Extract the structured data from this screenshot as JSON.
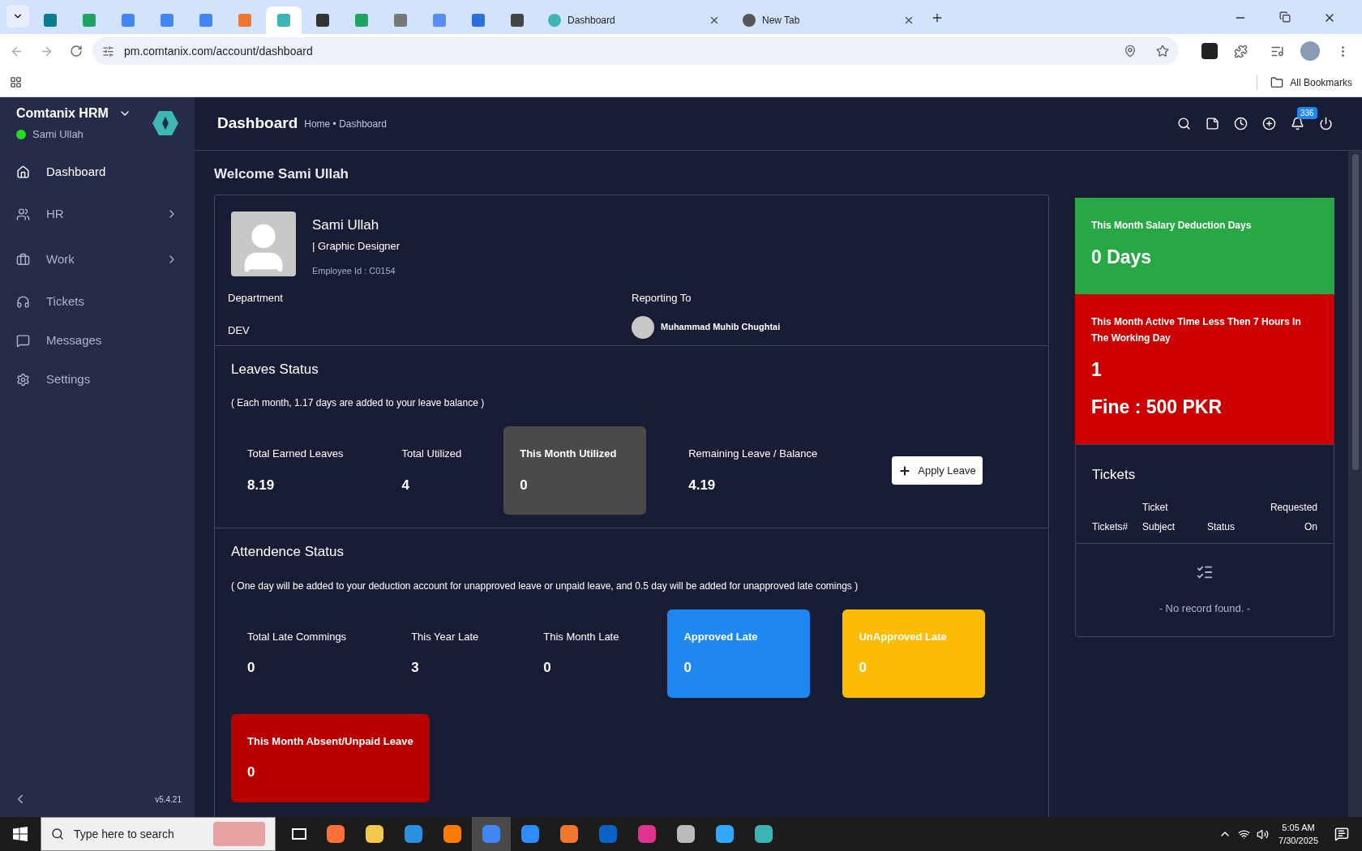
{
  "browser": {
    "tabs": [
      {
        "kind": "icon",
        "color": "#0b7c8f",
        "selected": false
      },
      {
        "kind": "icon",
        "color": "#1fa463",
        "selected": false
      },
      {
        "kind": "icon",
        "color": "#4285f4",
        "selected": false
      },
      {
        "kind": "icon",
        "color": "#4285f4",
        "selected": false
      },
      {
        "kind": "icon",
        "color": "#4285f4",
        "selected": false
      },
      {
        "kind": "icon",
        "color": "#f0772f",
        "selected": false
      },
      {
        "kind": "icon",
        "color": "#3cb4b4",
        "selected": true
      },
      {
        "kind": "icon",
        "color": "#333333",
        "selected": false
      },
      {
        "kind": "icon",
        "color": "#1fa463",
        "selected": false
      },
      {
        "kind": "icon",
        "color": "#777777",
        "selected": false
      },
      {
        "kind": "icon",
        "color": "#5b8def",
        "selected": false
      },
      {
        "kind": "icon",
        "color": "#2a6fdb",
        "selected": false
      },
      {
        "kind": "icon",
        "color": "#444444",
        "selected": false
      },
      {
        "kind": "titled",
        "color": "#3cb4b4",
        "title": "Dashboard",
        "selected": false
      },
      {
        "kind": "titled",
        "color": "#555555",
        "title": "New Tab",
        "selected": false
      }
    ],
    "url": "pm.comtanix.com/account/dashboard",
    "bookmarks": "All Bookmarks"
  },
  "sidebar": {
    "brand": "Comtanix HRM",
    "user": "Sami Ullah",
    "online": true,
    "items": [
      {
        "label": "Dashboard",
        "selected": true,
        "kind": "link"
      },
      {
        "label": "HR",
        "selected": false,
        "kind": "group"
      },
      {
        "label": "Work",
        "selected": false,
        "kind": "group"
      },
      {
        "label": "Tickets",
        "selected": false,
        "kind": "link"
      },
      {
        "label": "Messages",
        "selected": false,
        "kind": "link"
      },
      {
        "label": "Settings",
        "selected": false,
        "kind": "link"
      }
    ],
    "version": "v5.4.21"
  },
  "header": {
    "title": "Dashboard",
    "breadcrumb": "Home • Dashboard",
    "notification_count": "336"
  },
  "welcome": "Welcome Sami Ullah",
  "profile": {
    "name": "Sami Ullah",
    "role": "| Graphic Designer",
    "employee_id": "Employee Id : C0154",
    "department_label": "Department",
    "department": "DEV",
    "reporting_label": "Reporting To",
    "reporting_to": "Muhammad Muhib Chughtai"
  },
  "leaves": {
    "title": "Leaves Status",
    "note": "( Each month, 1.17 days are added to your leave balance )",
    "stats": [
      {
        "kind": "plain",
        "label": "Total Earned Leaves",
        "value": "8.19"
      },
      {
        "kind": "plain",
        "label": "Total Utilized",
        "value": "4"
      },
      {
        "kind": "card",
        "color": "#4a4a4a",
        "label": "This Month Utilized",
        "value": "0"
      },
      {
        "kind": "plain",
        "label": "Remaining Leave / Balance",
        "value": "4.19"
      }
    ],
    "button": "Apply Leave"
  },
  "attendance": {
    "title": "Attendence Status",
    "note": "( One day will be added to your deduction account for unapproved leave or unpaid leave, and 0.5 day will be added for unapproved late comings )",
    "stats": [
      {
        "kind": "plain",
        "label": "Total Late Commings",
        "value": "0"
      },
      {
        "kind": "plain",
        "label": "This Year Late",
        "value": "3"
      },
      {
        "kind": "plain",
        "label": "This Month Late",
        "value": "0"
      },
      {
        "kind": "card",
        "color": "#1e88f0",
        "label": "Approved Late",
        "value": "0"
      },
      {
        "kind": "card",
        "color": "#fcbc05",
        "label": "UnApproved Late",
        "value": "0"
      },
      {
        "kind": "card",
        "color": "#b80000",
        "label": "This Month Absent/Unpaid Leave",
        "value": "0"
      }
    ]
  },
  "deductions": [
    {
      "color": "#28a745",
      "title": "This Month Salary Deduction Days",
      "lines": [
        "0 Days"
      ]
    },
    {
      "color": "#cc0000",
      "title": "This Month Active Time Less Then 7 Hours In The Working Day",
      "lines": [
        "1",
        "Fine : 500 PKR"
      ]
    }
  ],
  "tickets": {
    "title": "Tickets",
    "columns": [
      "Tickets#",
      "Ticket Subject",
      "Status",
      "Requested On"
    ],
    "empty": "- No record found. -"
  },
  "taskbar": {
    "search": "Type here to search",
    "apps": [
      {
        "color": "#ff7139",
        "selected": false
      },
      {
        "color": "#f2c94c",
        "selected": false
      },
      {
        "color": "#2d8fe0",
        "selected": false
      },
      {
        "color": "#ff7c00",
        "selected": false
      },
      {
        "color": "#4285f4",
        "selected": true
      },
      {
        "color": "#2d8cff",
        "selected": false
      },
      {
        "color": "#f0772f",
        "selected": false
      },
      {
        "color": "#0a64c8",
        "selected": false
      },
      {
        "color": "#e0338d",
        "selected": false
      },
      {
        "color": "#bbbbbb",
        "selected": false
      },
      {
        "color": "#31a8ff",
        "selected": false
      },
      {
        "color": "#3cb4b4",
        "selected": false
      }
    ],
    "time": "5:05 AM",
    "date": "7/30/2025"
  }
}
